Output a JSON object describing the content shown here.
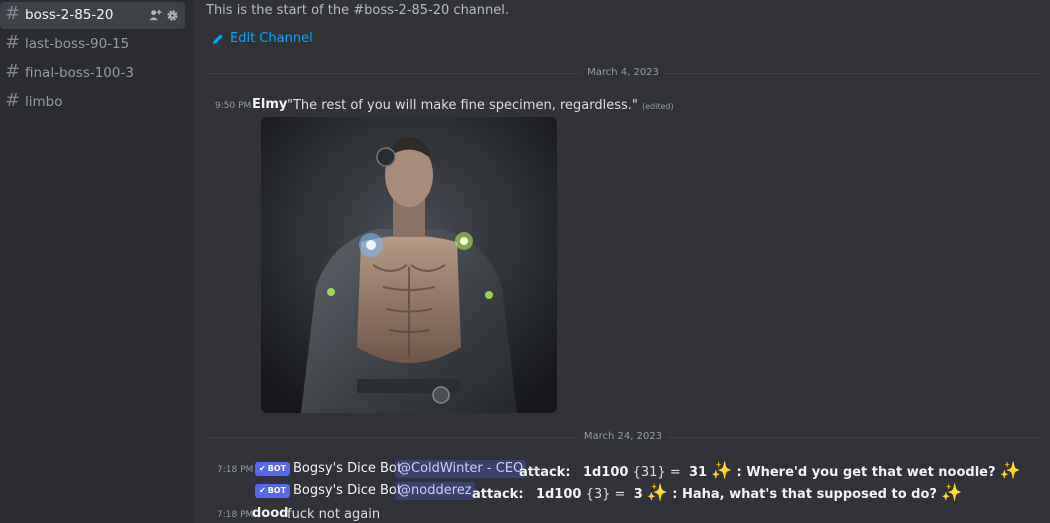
{
  "sidebar": {
    "channels": [
      {
        "name": "boss-2-85-20",
        "active": true
      },
      {
        "name": "last-boss-90-15",
        "active": false
      },
      {
        "name": "final-boss-100-3",
        "active": false
      },
      {
        "name": "limbo",
        "active": false
      }
    ],
    "hash": "#"
  },
  "channel": {
    "intro": "This is the start of the #boss-2-85-20 channel.",
    "edit_label": "Edit Channel"
  },
  "dates": [
    "March 4, 2023",
    "March 24, 2023"
  ],
  "messages": [
    {
      "time": "9:50 PM",
      "author": "Elmy",
      "text": "\"The rest of you will make fine specimen, regardless.\"",
      "edited": "(edited)"
    },
    {
      "time": "7:18 PM",
      "badge": "BOT",
      "author": "Bogsy's Dice Bot",
      "mention": "@ColdWinter - CEO",
      "attack": "attack:",
      "roll": "1d100",
      "roll_detail": "{31}",
      "equals": "=",
      "result": "31",
      "comment": ": Where'd you get that wet noodle?"
    },
    {
      "badge": "BOT",
      "author": "Bogsy's Dice Bot",
      "mention": "@nodderez",
      "attack": "attack:",
      "roll": "1d100",
      "roll_detail": "{3}",
      "equals": "=",
      "result": "3",
      "comment": ": Haha, what's that supposed to do?"
    },
    {
      "time": "7:18 PM",
      "author": "dood",
      "text": "fuck not again"
    }
  ],
  "colors": {
    "background": "#313338",
    "sidebar": "#2b2d31",
    "link": "#00a8fc",
    "bot_badge": "#5865f2"
  },
  "icons": [
    "hash-icon",
    "add-member-icon",
    "gear-icon",
    "pencil-icon",
    "sparkles-icon",
    "checkmark-icon"
  ]
}
